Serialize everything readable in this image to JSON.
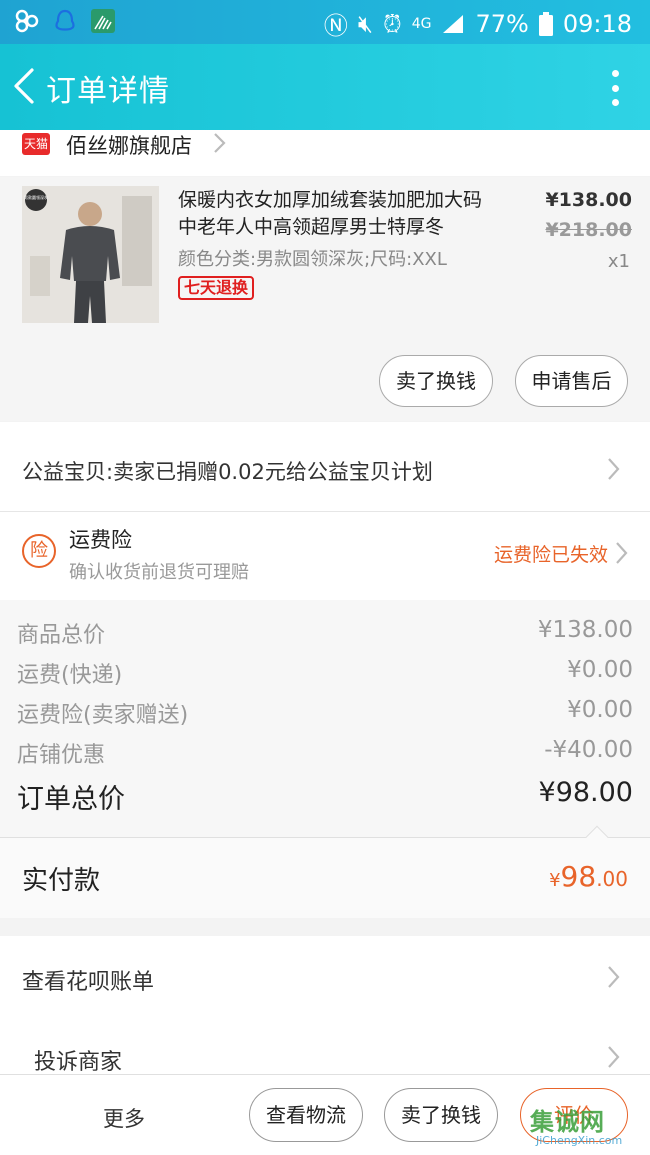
{
  "status_bar": {
    "network": "4G",
    "battery": "77%",
    "time": "09:18"
  },
  "nav": {
    "title": "订单详情"
  },
  "shop": {
    "badge": "天猫",
    "name": "佰丝娜旗舰店"
  },
  "product": {
    "image_caption": "男款圆领深灰",
    "title": "保暖内衣女加厚加绒套装加肥加大码中老年人中高领超厚男士特厚冬",
    "sku": "颜色分类:男款圆领深灰;尺码:XXL",
    "tag": "七天退换",
    "price": "¥138.00",
    "original_price": "¥218.00",
    "quantity": "x1",
    "buttons": [
      "卖了换钱",
      "申请售后"
    ]
  },
  "charity": {
    "text": "公益宝贝:卖家已捐赠0.02元给公益宝贝计划"
  },
  "insurance": {
    "icon_char": "险",
    "title": "运费险",
    "subtitle": "确认收货前退货可理赔",
    "status": "运费险已失效"
  },
  "summary": {
    "rows": [
      {
        "label": "商品总价",
        "value": "¥138.00"
      },
      {
        "label": "运费(快递)",
        "value": "¥0.00"
      },
      {
        "label": "运费险(卖家赠送)",
        "value": "¥0.00"
      },
      {
        "label": "店铺优惠",
        "value": "-¥40.00"
      }
    ],
    "total_label": "订单总价",
    "total_value": "¥98.00"
  },
  "paid": {
    "label": "实付款",
    "currency": "¥",
    "integer": "98",
    "decimal": ".00"
  },
  "actions": {
    "huabei": "查看花呗账单",
    "complain": "投诉商家"
  },
  "bottom_bar": {
    "more": "更多",
    "logistics": "查看物流",
    "resell": "卖了换钱",
    "review": "评价"
  },
  "watermark": {
    "main": "集诚网",
    "sub": "JiChengXin.com"
  },
  "colors": {
    "accent": "#e8642a",
    "nav_bg": "#22c6dc",
    "tmall_red": "#e82b2b"
  }
}
